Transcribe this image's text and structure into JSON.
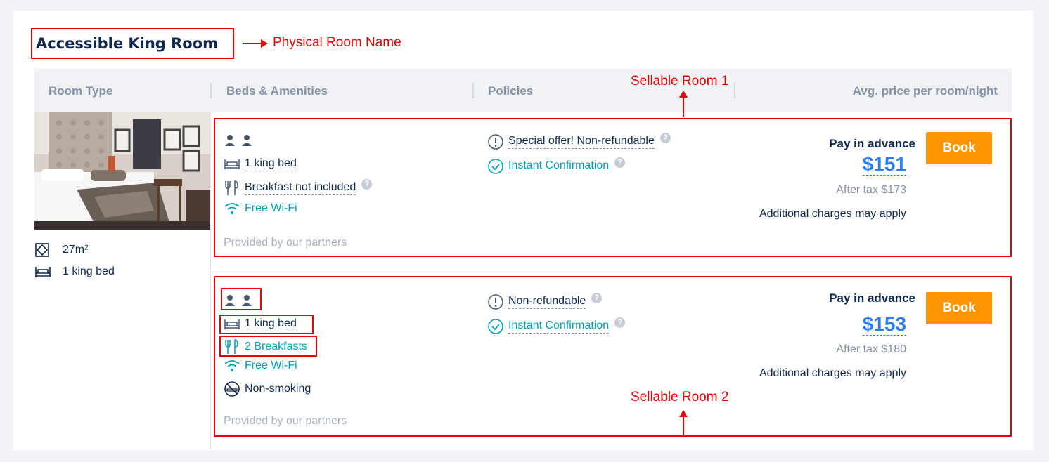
{
  "room": {
    "name": "Accessible King Room",
    "size": "27m²",
    "bed": "1 king bed"
  },
  "annotations": {
    "physical_room_name": "Physical Room Name",
    "sellable_room_1": "Sellable Room 1",
    "sellable_room_2": "Sellable Room 2"
  },
  "table_header": {
    "room_type": "Room Type",
    "beds_amenities": "Beds & Amenities",
    "policies": "Policies",
    "price": "Avg. price per room/night"
  },
  "offers": [
    {
      "bed": "1 king bed",
      "meal": "Breakfast not included",
      "wifi": "Free Wi-Fi",
      "policy": "Special offer! Non-refundable",
      "confirmation": "Instant Confirmation",
      "provider": "Provided by our partners",
      "pay_label": "Pay in advance",
      "price": "$151",
      "after_tax": "After tax $173",
      "additional": "Additional charges may apply",
      "book_label": "Book"
    },
    {
      "bed": "1 king bed",
      "meal": "2 Breakfasts",
      "wifi": "Free Wi-Fi",
      "smoking": "Non-smoking",
      "policy": "Non-refundable",
      "confirmation": "Instant Confirmation",
      "provider": "Provided by our partners",
      "pay_label": "Pay in advance",
      "price": "$153",
      "after_tax": "After tax $180",
      "additional": "Additional charges may apply",
      "book_label": "Book"
    }
  ],
  "colors": {
    "accent": "#287dfa",
    "book": "#ff9500",
    "teal": "#00a2b3",
    "annotation": "#e60000"
  }
}
